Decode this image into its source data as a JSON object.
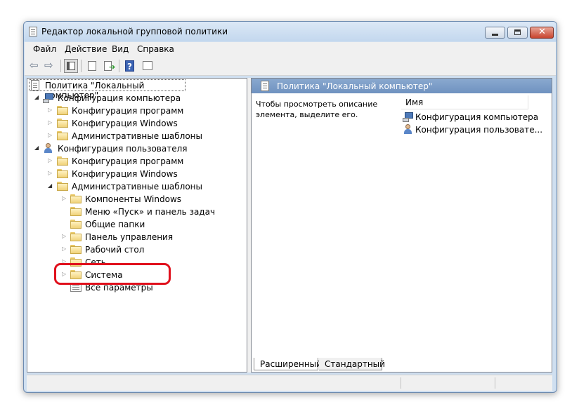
{
  "window": {
    "title": "Редактор локальной групповой политики"
  },
  "menu": [
    "Файл",
    "Действие",
    "Вид",
    "Справка"
  ],
  "toolbar": {
    "icons": [
      "back-arrow-icon",
      "forward-arrow-icon",
      "show-hide-tree-icon",
      "properties-icon",
      "export-list-icon",
      "help-icon",
      "filter-icon"
    ]
  },
  "tree": {
    "root": "Политика \"Локальный компьютер\"",
    "computer_config": "Конфигурация компьютера",
    "user_config": "Конфигурация пользователя",
    "software_settings": "Конфигурация программ",
    "windows_settings": "Конфигурация Windows",
    "admin_templates": "Административные шаблоны",
    "windows_components": "Компоненты Windows",
    "start_menu": "Меню «Пуск» и панель задач",
    "shared_folders": "Общие папки",
    "control_panel": "Панель управления",
    "desktop": "Рабочий стол",
    "network": "Сеть",
    "system": "Система",
    "all_settings": "Все параметры"
  },
  "right_panel": {
    "header": "Политика \"Локальный компьютер\"",
    "description": "Чтобы просмотреть описание элемента, выделите его.",
    "column_name": "Имя",
    "items": [
      "Конфигурация компьютера",
      "Конфигурация пользовате..."
    ]
  },
  "tabs": {
    "extended": "Расширенный",
    "standard": "Стандартный"
  },
  "colors": {
    "highlight": "#e0101c",
    "header": "#7a9ac6"
  }
}
